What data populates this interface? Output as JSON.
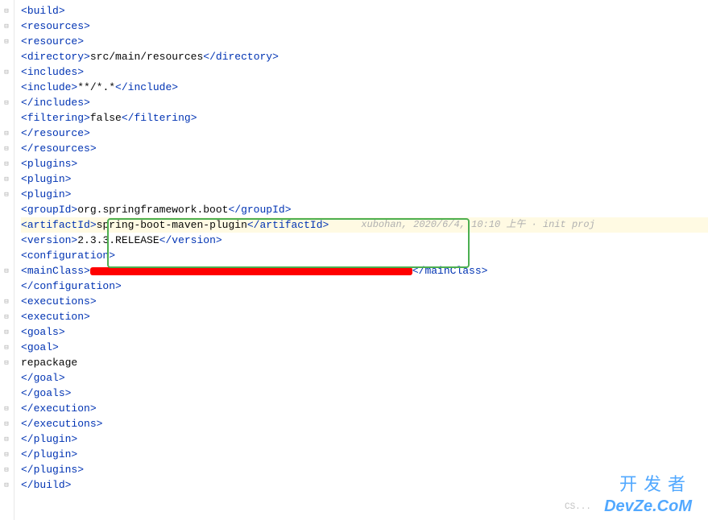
{
  "xml": {
    "build": "build",
    "resources": "resources",
    "resource": "resource",
    "directory": "directory",
    "directory_val": "src/main/resources",
    "includes": "includes",
    "include": "include",
    "include_val": "**/*.*",
    "filtering": "filtering",
    "filtering_val": "false",
    "plugins": "plugins",
    "plugin": "plugin",
    "groupId": "groupId",
    "groupId_val": "org.springframework.boot",
    "artifactId": "artifactId",
    "artifactId_val": "spring-boot-maven-plugin",
    "version": "version",
    "version_val": "2.3.3.RELEASE",
    "configuration": "configuration",
    "mainClass": "mainClass",
    "executions": "executions",
    "execution": "execution",
    "goals": "goals",
    "goal": "goal",
    "goal_val": "repackage"
  },
  "blame": "xubohan, 2020/6/4, 10:10 上午 · init proj",
  "wm": {
    "cn": "开发者",
    "en": "DevZe.CoM",
    "faint": "CS..."
  }
}
